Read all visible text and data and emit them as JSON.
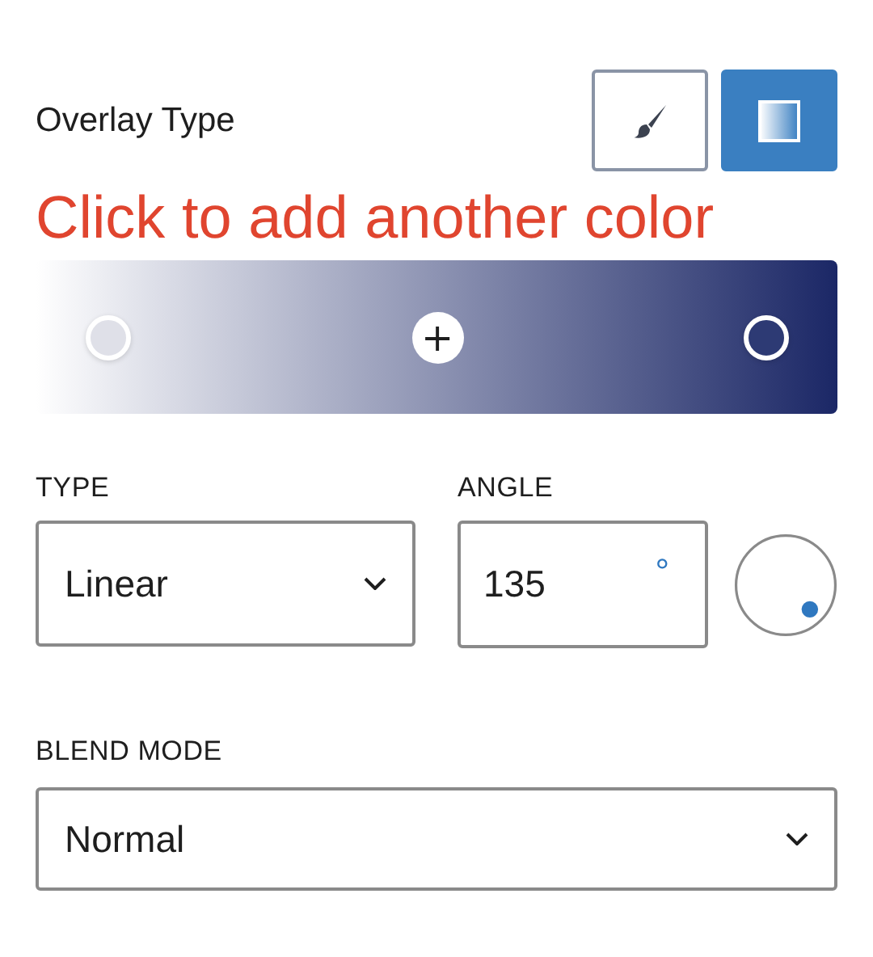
{
  "overlay_type": {
    "label": "Overlay Type",
    "options": [
      {
        "kind": "color",
        "selected": false
      },
      {
        "kind": "gradient",
        "selected": true
      }
    ]
  },
  "annotation": "Click to add another color",
  "gradient_bar": {
    "ends": [
      {
        "color": "#ffffff"
      },
      {
        "color": "#1b2766"
      }
    ],
    "stops": [
      {
        "kind": "stop",
        "color": "#dfe0e8"
      },
      {
        "kind": "add",
        "text": "+"
      },
      {
        "kind": "stop",
        "color": "#2d3a74"
      }
    ]
  },
  "type": {
    "label": "TYPE",
    "value": "Linear"
  },
  "angle": {
    "label": "ANGLE",
    "value": "135",
    "unit": "°"
  },
  "blend_mode": {
    "label": "BLEND MODE",
    "value": "Normal"
  }
}
